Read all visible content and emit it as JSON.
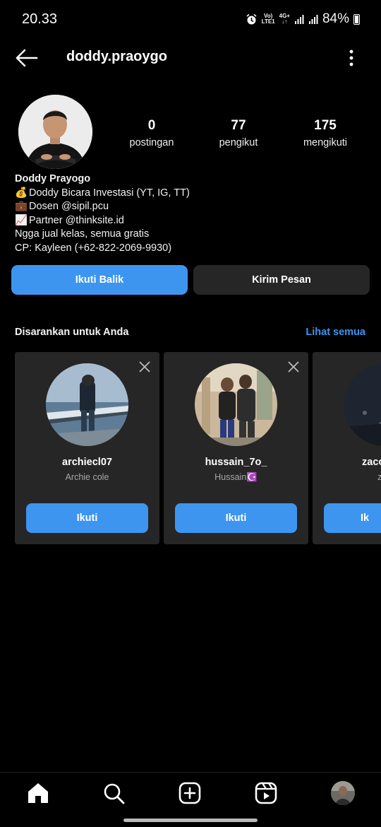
{
  "status_bar": {
    "time": "20.33",
    "net_top": "Vo)",
    "net_bottom": "LTE1",
    "net4g_top": "4G+",
    "net4g_bottom": "↓↑",
    "battery": "84%"
  },
  "header": {
    "username": "doddy.praoygo"
  },
  "profile": {
    "stats": [
      {
        "value": "0",
        "label": "postingan"
      },
      {
        "value": "77",
        "label": "pengikut"
      },
      {
        "value": "175",
        "label": "mengikuti"
      }
    ],
    "name": "Doddy Prayogo",
    "bio_lines": [
      {
        "emoji": "💰",
        "text": "Doddy Bicara Investasi (YT, IG, TT)"
      },
      {
        "emoji": "💼",
        "text": "Dosen @sipil.pcu"
      },
      {
        "emoji": "📈",
        "text": "Partner @thinksite.id"
      },
      {
        "emoji": "",
        "text": "Ngga jual kelas, semua gratis"
      },
      {
        "emoji": "",
        "text": "CP: Kayleen (+62-822-2069-9930)"
      }
    ]
  },
  "actions": {
    "follow_back": "Ikuti Balik",
    "send_message": "Kirim Pesan"
  },
  "suggestions": {
    "title": "Disarankan untuk Anda",
    "see_all": "Lihat semua",
    "cards": [
      {
        "username": "archiecl07",
        "name": "Archie cole",
        "button": "Ikuti"
      },
      {
        "username": "hussain_7o_",
        "name": "Hussain☪️",
        "button": "Ikuti"
      },
      {
        "username": "zaco",
        "name": "z",
        "button": "Ik"
      }
    ]
  },
  "colors": {
    "accent": "#3d95ef",
    "card_bg": "#262626",
    "background": "#000000"
  },
  "nav": {
    "icons": [
      "home-icon",
      "search-icon",
      "create-icon",
      "reels-icon",
      "profile-avatar"
    ]
  }
}
